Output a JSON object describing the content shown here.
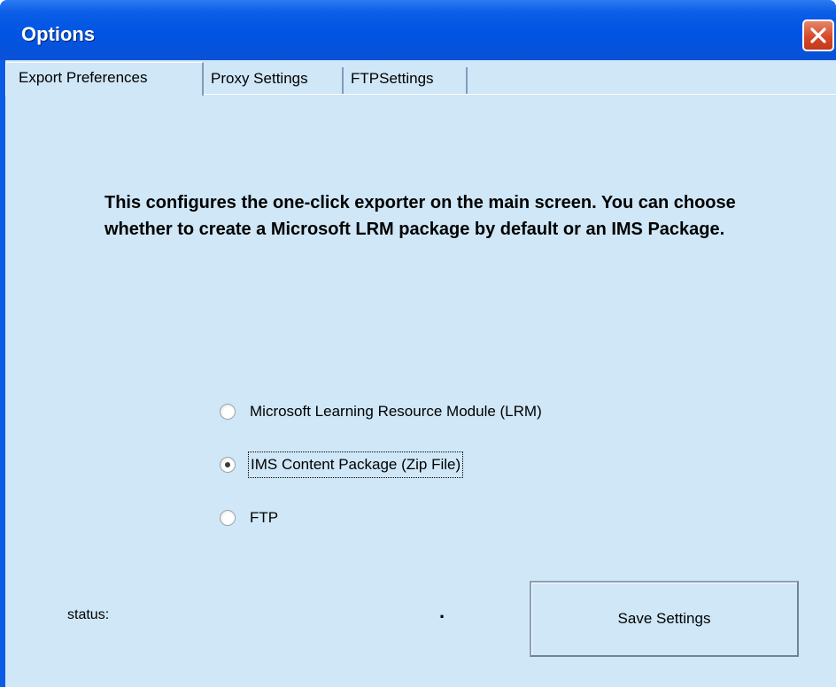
{
  "window": {
    "title": "Options"
  },
  "tabs": [
    {
      "label": "Export Preferences",
      "active": true
    },
    {
      "label": "Proxy Settings",
      "active": false
    },
    {
      "label": "FTPSettings",
      "active": false
    }
  ],
  "description": "This configures the one-click exporter on the main screen.  You can choose whether to create a Microsoft LRM package by default or an IMS Package.",
  "export_options": [
    {
      "label": "Microsoft Learning Resource Module (LRM)",
      "selected": false
    },
    {
      "label": "IMS Content Package (Zip File)",
      "selected": true
    },
    {
      "label": "FTP",
      "selected": false
    }
  ],
  "status": {
    "label": "status:",
    "value": "."
  },
  "save_button": {
    "label": "Save Settings"
  },
  "icons": {
    "close": "close-icon",
    "radio": "radio-button"
  },
  "colors": {
    "titlebar": "#0054e3",
    "client": "#cfe7f7",
    "close_button": "#d8482a"
  }
}
